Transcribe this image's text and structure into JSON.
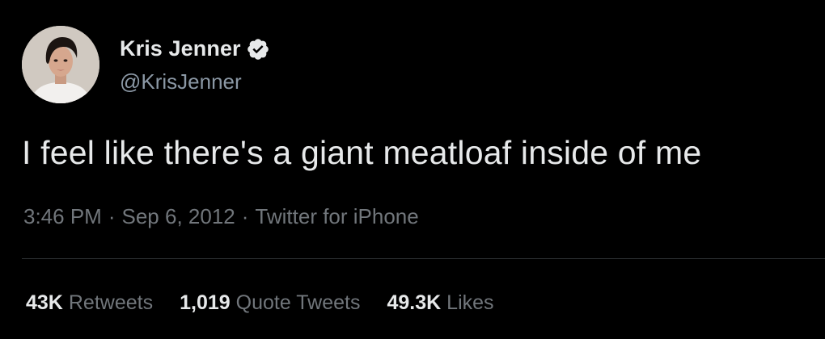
{
  "user": {
    "display_name": "Kris Jenner",
    "handle": "@KrisJenner",
    "verified_icon": "verified-badge-icon"
  },
  "tweet": {
    "text": "I feel like there's a giant meatloaf inside of me",
    "time": "3:46 PM",
    "date": "Sep 6, 2012",
    "source": "Twitter for iPhone",
    "separator": "·"
  },
  "stats": {
    "retweets": {
      "count": "43K",
      "label": "Retweets"
    },
    "quote_tweets": {
      "count": "1,019",
      "label": "Quote Tweets"
    },
    "likes": {
      "count": "49.3K",
      "label": "Likes"
    }
  },
  "colors": {
    "background": "#000000",
    "primary_text": "#e7e9ea",
    "secondary_text": "#71767b",
    "divider": "#2f3336"
  }
}
